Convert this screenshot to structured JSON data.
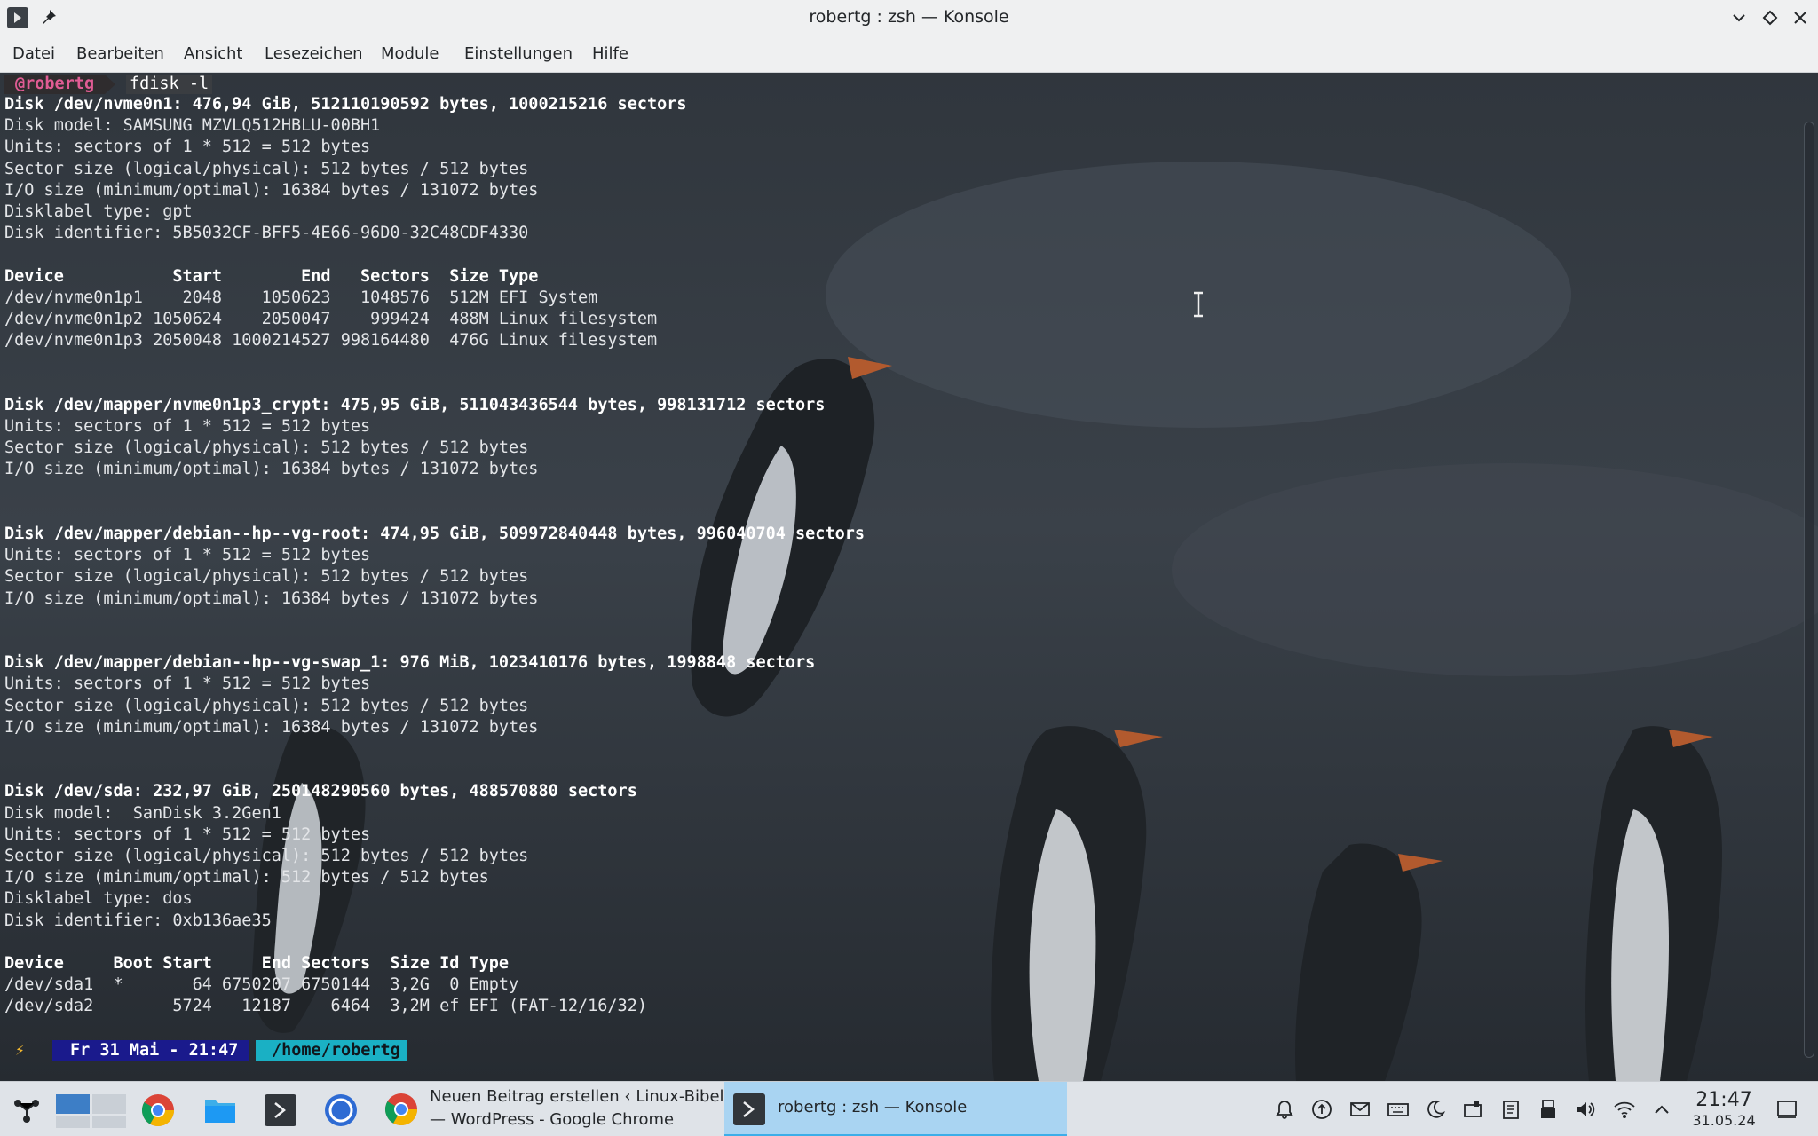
{
  "window": {
    "title": "robertg : zsh — Konsole",
    "menu": [
      "Datei",
      "Bearbeiten",
      "Ansicht",
      "Lesezeichen",
      "Module",
      "Einstellungen",
      "Hilfe"
    ]
  },
  "terminal": {
    "prompt_user": "@robertg",
    "command": "fdisk -l",
    "output_lines": [
      {
        "text": "Disk /dev/nvme0n1: 476,94 GiB, 512110190592 bytes, 1000215216 sectors",
        "bold": true
      },
      {
        "text": "Disk model: SAMSUNG MZVLQ512HBLU-00BH1",
        "bold": false
      },
      {
        "text": "Units: sectors of 1 * 512 = 512 bytes",
        "bold": false
      },
      {
        "text": "Sector size (logical/physical): 512 bytes / 512 bytes",
        "bold": false
      },
      {
        "text": "I/O size (minimum/optimal): 16384 bytes / 131072 bytes",
        "bold": false
      },
      {
        "text": "Disklabel type: gpt",
        "bold": false
      },
      {
        "text": "Disk identifier: 5B5032CF-BFF5-4E66-96D0-32C48CDF4330",
        "bold": false
      },
      {
        "text": "",
        "bold": false
      },
      {
        "text": "Device           Start        End   Sectors  Size Type",
        "bold": true
      },
      {
        "text": "/dev/nvme0n1p1    2048    1050623   1048576  512M EFI System",
        "bold": false
      },
      {
        "text": "/dev/nvme0n1p2 1050624    2050047    999424  488M Linux filesystem",
        "bold": false
      },
      {
        "text": "/dev/nvme0n1p3 2050048 1000214527 998164480  476G Linux filesystem",
        "bold": false
      },
      {
        "text": "",
        "bold": false
      },
      {
        "text": "",
        "bold": false
      },
      {
        "text": "Disk /dev/mapper/nvme0n1p3_crypt: 475,95 GiB, 511043436544 bytes, 998131712 sectors",
        "bold": true
      },
      {
        "text": "Units: sectors of 1 * 512 = 512 bytes",
        "bold": false
      },
      {
        "text": "Sector size (logical/physical): 512 bytes / 512 bytes",
        "bold": false
      },
      {
        "text": "I/O size (minimum/optimal): 16384 bytes / 131072 bytes",
        "bold": false
      },
      {
        "text": "",
        "bold": false
      },
      {
        "text": "",
        "bold": false
      },
      {
        "text": "Disk /dev/mapper/debian--hp--vg-root: 474,95 GiB, 509972840448 bytes, 996040704 sectors",
        "bold": true
      },
      {
        "text": "Units: sectors of 1 * 512 = 512 bytes",
        "bold": false
      },
      {
        "text": "Sector size (logical/physical): 512 bytes / 512 bytes",
        "bold": false
      },
      {
        "text": "I/O size (minimum/optimal): 16384 bytes / 131072 bytes",
        "bold": false
      },
      {
        "text": "",
        "bold": false
      },
      {
        "text": "",
        "bold": false
      },
      {
        "text": "Disk /dev/mapper/debian--hp--vg-swap_1: 976 MiB, 1023410176 bytes, 1998848 sectors",
        "bold": true
      },
      {
        "text": "Units: sectors of 1 * 512 = 512 bytes",
        "bold": false
      },
      {
        "text": "Sector size (logical/physical): 512 bytes / 512 bytes",
        "bold": false
      },
      {
        "text": "I/O size (minimum/optimal): 16384 bytes / 131072 bytes",
        "bold": false
      },
      {
        "text": "",
        "bold": false
      },
      {
        "text": "",
        "bold": false
      },
      {
        "text": "Disk /dev/sda: 232,97 GiB, 250148290560 bytes, 488570880 sectors",
        "bold": true
      },
      {
        "text": "Disk model:  SanDisk 3.2Gen1",
        "bold": false
      },
      {
        "text": "Units: sectors of 1 * 512 = 512 bytes",
        "bold": false
      },
      {
        "text": "Sector size (logical/physical): 512 bytes / 512 bytes",
        "bold": false
      },
      {
        "text": "I/O size (minimum/optimal): 512 bytes / 512 bytes",
        "bold": false
      },
      {
        "text": "Disklabel type: dos",
        "bold": false
      },
      {
        "text": "Disk identifier: 0xb136ae35",
        "bold": false
      },
      {
        "text": "",
        "bold": false
      },
      {
        "text": "Device     Boot Start     End Sectors  Size Id Type",
        "bold": true
      },
      {
        "text": "/dev/sda1  *       64 6750207 6750144  3,2G  0 Empty",
        "bold": false
      },
      {
        "text": "/dev/sda2        5724   12187    6464  3,2M ef EFI (FAT-12/16/32)",
        "bold": false
      }
    ],
    "prompt2": {
      "bolt": "⚡",
      "datetime": "Fr 31 Mai - 21:47",
      "path": "/home/robertg"
    }
  },
  "taskbar": {
    "tasks": [
      {
        "label_line1": "Neuen Beitrag erstellen ‹ Linux-Bibel",
        "label_line2": "— WordPress - Google Chrome"
      },
      {
        "label": "robertg : zsh — Konsole"
      }
    ],
    "clock": {
      "time": "21:47",
      "date": "31.05.24"
    }
  }
}
